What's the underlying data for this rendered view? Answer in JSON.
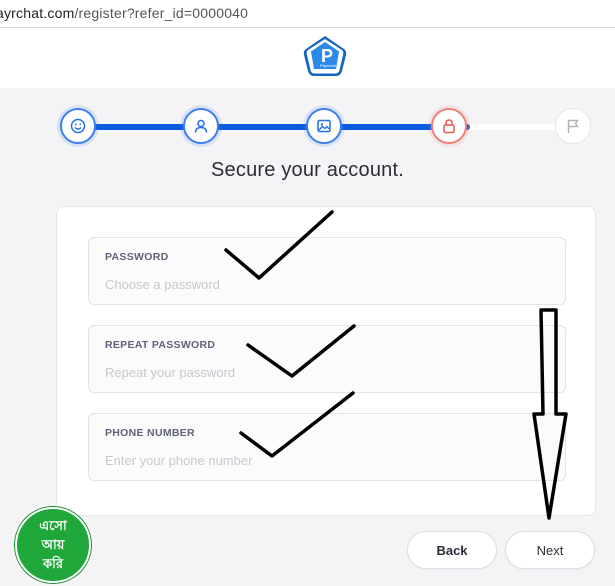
{
  "browser": {
    "url_domain": "ayrchat.com",
    "url_path": "/register?refer_id=0000040"
  },
  "logo": {
    "text": "Payrchat"
  },
  "stepper": {
    "steps": [
      {
        "icon": "smiley-icon",
        "state": "done"
      },
      {
        "icon": "user-icon",
        "state": "done"
      },
      {
        "icon": "image-icon",
        "state": "done"
      },
      {
        "icon": "lock-icon",
        "state": "current"
      },
      {
        "icon": "flag-icon",
        "state": "todo"
      }
    ],
    "accent_color": "#0a5be0",
    "current_color": "#f0807a"
  },
  "page_title": "Secure your account.",
  "form": {
    "password": {
      "label": "PASSWORD",
      "placeholder": "Choose a password",
      "value": ""
    },
    "repeat_password": {
      "label": "REPEAT PASSWORD",
      "placeholder": "Repeat your password",
      "value": ""
    },
    "phone": {
      "label": "PHONE NUMBER",
      "placeholder": "Enter your phone number",
      "value": ""
    }
  },
  "buttons": {
    "back": "Back",
    "next": "Next"
  },
  "badge": {
    "lines": [
      "এসো",
      "আয়",
      "করি"
    ],
    "color": "#1fa73a"
  },
  "annotations": {
    "checkmarks": 3,
    "arrow": "down-arrow"
  }
}
